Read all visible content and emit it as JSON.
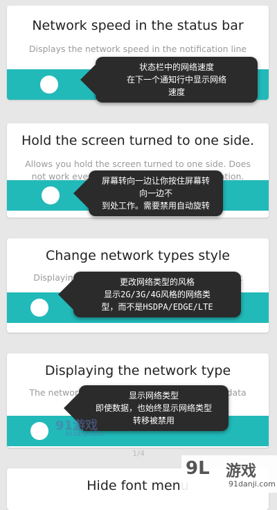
{
  "cards": [
    {
      "title": "Network speed in the status bar",
      "description": "Displays the network speed in the notification line next to the clock",
      "tooltip": [
        "状态栏中的网络速度",
        "在下一个通知行中显示网络",
        "速度"
      ]
    },
    {
      "title": "Hold the screen turned to one side.",
      "description": "Allows you hold the screen turned to one side. Does not work everywhere. Need disable autorotation.",
      "tooltip": [
        "屏幕转向一边让你按住屏幕转",
        "向一边不",
        "到处工作。需要禁用自动旋转"
      ]
    },
    {
      "title": "Change network types style",
      "description": "Displaying network types in 2G/3G/4G style, not HSDPA/EDGE/LTE",
      "tooltip": [
        "更改网络类型的风格",
        "显示2G/3G/4G风格的网络类",
        "型，而不是HSDPA/EDGE/LTE"
      ]
    },
    {
      "title": "Displaying the network type",
      "description": "The network type is always displayed even if data transfer is disabled",
      "tooltip": [
        "显示网络类型",
        "即使数据，也始终显示网络类型",
        "转移被禁用"
      ]
    },
    {
      "title": "Hide font menu"
    }
  ],
  "pager": "1/4",
  "watermark": {
    "left_logo": "91游戏",
    "left_url": "91danji.com",
    "right_logo": "9L",
    "right_cn": "游戏",
    "right_url": "91danji.com"
  }
}
